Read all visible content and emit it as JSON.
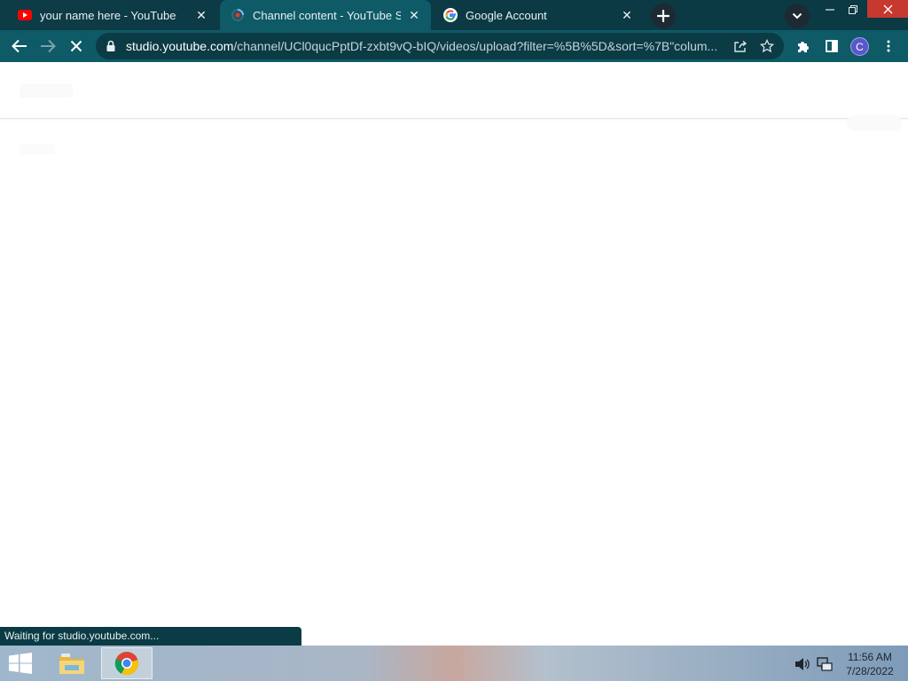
{
  "browser": {
    "tabs": [
      {
        "title": "your name here - YouTube",
        "favicon": "youtube-icon",
        "active": false
      },
      {
        "title": "Channel content - YouTube Studio",
        "favicon": "loading-spinner-icon",
        "active": true
      },
      {
        "title": "Google Account",
        "favicon": "google-g-icon",
        "active": false
      }
    ],
    "address": {
      "host": "studio.youtube.com",
      "path": "/channel/UCl0qucPptDf-zxbt9vQ-bIQ/videos/upload?filter=%5B%5D&sort=%7B\"colum..."
    },
    "profile_initial": "C",
    "status_text": "Waiting for studio.youtube.com..."
  },
  "taskbar": {
    "time": "11:56 AM",
    "date": "7/28/2022"
  },
  "colors": {
    "toolbar": "#0e5a66",
    "tabstrip": "#0b3944",
    "close_button": "#c7382f"
  }
}
